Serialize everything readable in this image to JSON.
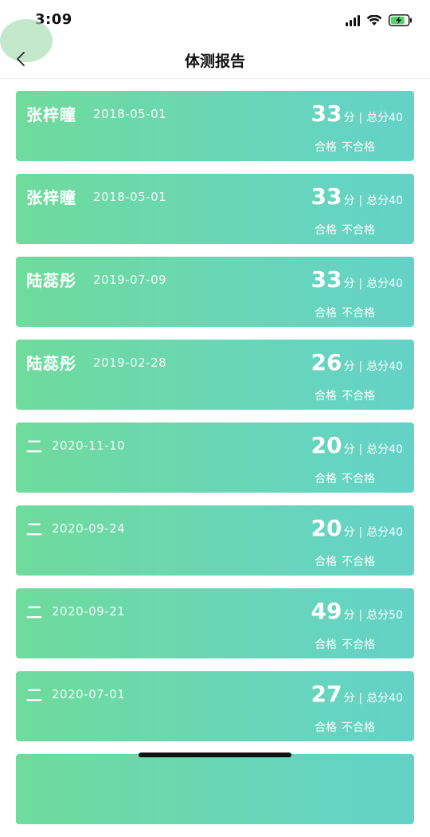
{
  "status": {
    "time": "3:09",
    "icons": [
      "signal-icon",
      "wifi-icon",
      "battery-icon"
    ]
  },
  "nav": {
    "back_icon": "chevron-left-icon",
    "title": "体测报告"
  },
  "records": [
    {
      "name": "张梓瞳",
      "date": "2018-05-01",
      "score": "33",
      "unit": "分",
      "separator": "|",
      "total": "总分40",
      "pass": "合格",
      "fail": "不合格"
    },
    {
      "name": "张梓瞳",
      "date": "2018-05-01",
      "score": "33",
      "unit": "分",
      "separator": "|",
      "total": "总分40",
      "pass": "合格",
      "fail": "不合格"
    },
    {
      "name": "陆蕊彤",
      "date": "2019-07-09",
      "score": "33",
      "unit": "分",
      "separator": "|",
      "total": "总分40",
      "pass": "合格",
      "fail": "不合格"
    },
    {
      "name": "陆蕊彤",
      "date": "2019-02-28",
      "score": "26",
      "unit": "分",
      "separator": "|",
      "total": "总分40",
      "pass": "合格",
      "fail": "不合格"
    },
    {
      "name": "二",
      "date": "2020-11-10",
      "score": "20",
      "unit": "分",
      "separator": "|",
      "total": "总分40",
      "pass": "合格",
      "fail": "不合格"
    },
    {
      "name": "二",
      "date": "2020-09-24",
      "score": "20",
      "unit": "分",
      "separator": "|",
      "total": "总分40",
      "pass": "合格",
      "fail": "不合格"
    },
    {
      "name": "二",
      "date": "2020-09-21",
      "score": "49",
      "unit": "分",
      "separator": "|",
      "total": "总分50",
      "pass": "合格",
      "fail": "不合格"
    },
    {
      "name": "二",
      "date": "2020-07-01",
      "score": "27",
      "unit": "分",
      "separator": "|",
      "total": "总分40",
      "pass": "合格",
      "fail": "不合格"
    },
    {
      "name": "",
      "date": "",
      "score": "",
      "unit": "",
      "separator": "",
      "total": "",
      "pass": "",
      "fail": ""
    }
  ],
  "colors": {
    "card_gradient_start": "#6fdb9c",
    "card_gradient_end": "#64d2c8",
    "text_on_card": "#ffffff",
    "touch_circle": "#a5dcb0"
  }
}
